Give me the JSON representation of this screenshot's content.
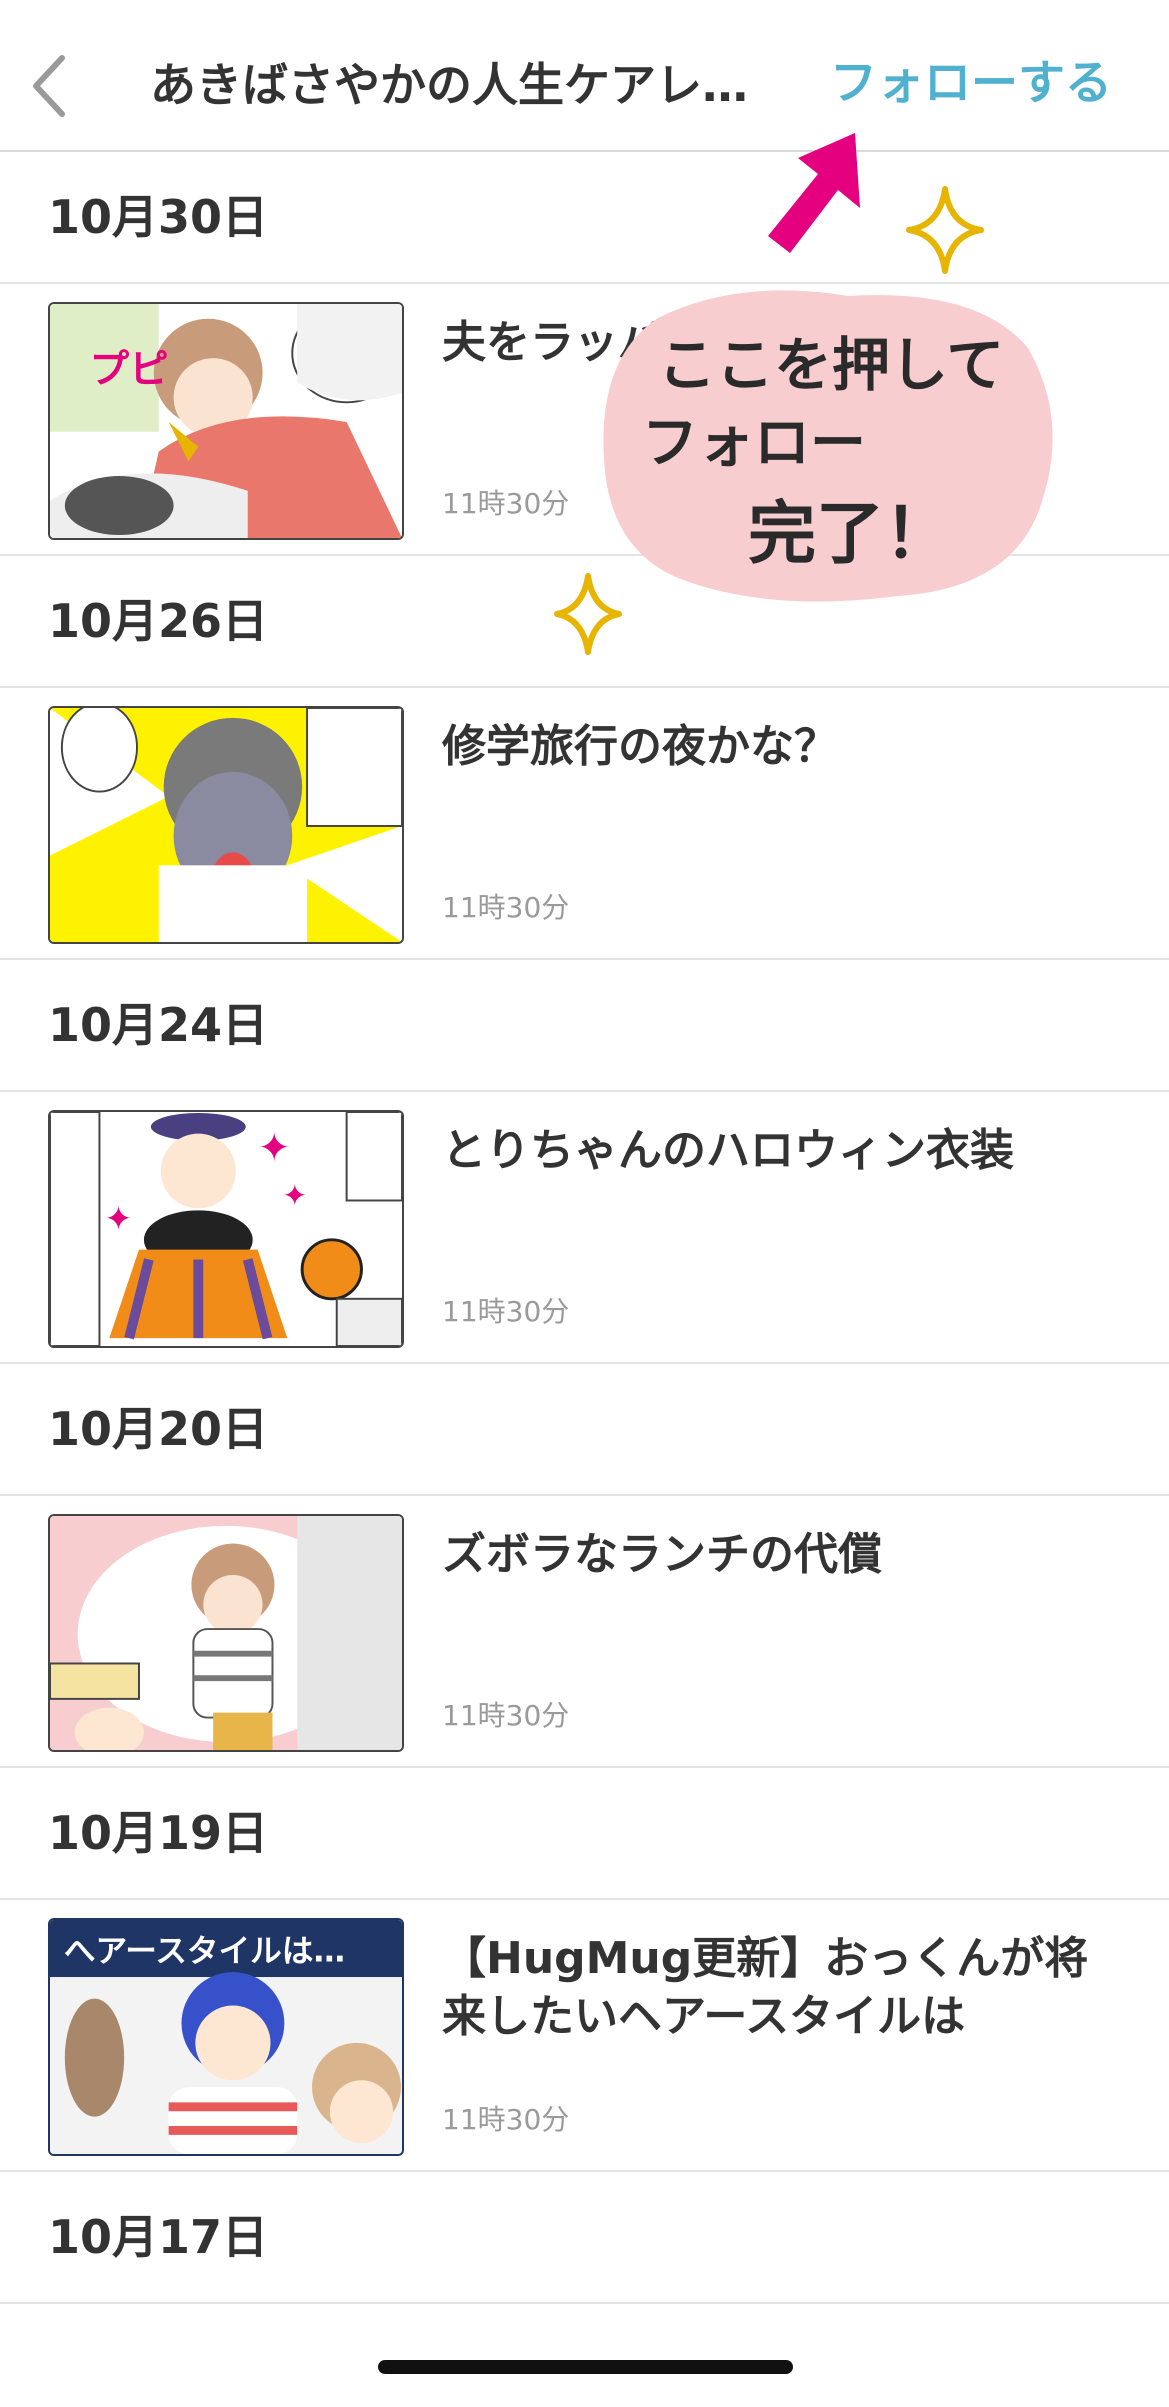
{
  "header": {
    "title": "あきばさやかの人生ケアレ…",
    "follow_label": "フォローする",
    "back_icon": "chevron-left-icon",
    "follow_color": "#4fb0cf"
  },
  "annotation": {
    "line1": "ここを押して",
    "line2": "フォロー",
    "line3": "完了！",
    "blob_color": "#f8cdd0",
    "arrow_color": "#e4007f",
    "sparkle_color": "#e7b400"
  },
  "feed": [
    {
      "date": "10月30日",
      "title": "夫をラッパで起こした結果",
      "time": "11時30分",
      "thumb_icon": "manga-trumpet-thumbnail"
    },
    {
      "date": "10月26日",
      "title": "修学旅行の夜かな？",
      "time": "11時30分",
      "thumb_icon": "manga-shout-thumbnail"
    },
    {
      "date": "10月24日",
      "title": "とりちゃんのハロウィン衣装",
      "time": "11時30分",
      "thumb_icon": "manga-halloween-thumbnail"
    },
    {
      "date": "10月20日",
      "title": "ズボラなランチの代償",
      "time": "11時30分",
      "thumb_icon": "manga-lunch-thumbnail"
    },
    {
      "date": "10月19日",
      "title": "【HugMug更新】おっくんが将来したいヘアースタイルは",
      "time": "11時30分",
      "thumb_icon": "manga-hairstyle-thumbnail"
    },
    {
      "date": "10月17日"
    }
  ]
}
